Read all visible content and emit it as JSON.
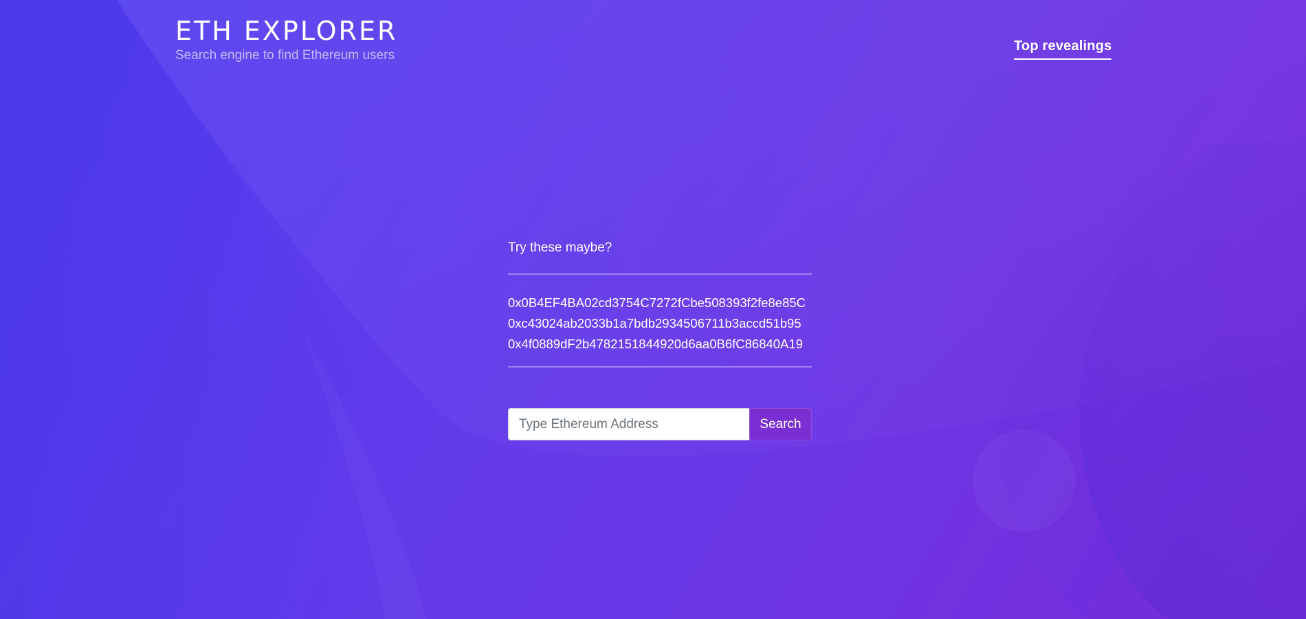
{
  "header": {
    "title": "ETH EXPLORER",
    "subtitle": "Search engine to find Ethereum users",
    "nav_link": "Top revealings"
  },
  "suggestions": {
    "label": "Try these maybe?",
    "addresses": [
      "0x0B4EF4BA02cd3754C7272fCbe508393f2fe8e85C",
      "0xc43024ab2033b1a7bdb2934506711b3accd51b95",
      "0x4f0889dF2b4782151844920d6aa0B6fC86840A19"
    ]
  },
  "search": {
    "placeholder": "Type Ethereum Address",
    "value": "",
    "button_label": "Search"
  },
  "colors": {
    "background_start": "#4f3df0",
    "background_end": "#7a2ad9",
    "button": "#7b2fd3",
    "text": "#ffffff"
  }
}
